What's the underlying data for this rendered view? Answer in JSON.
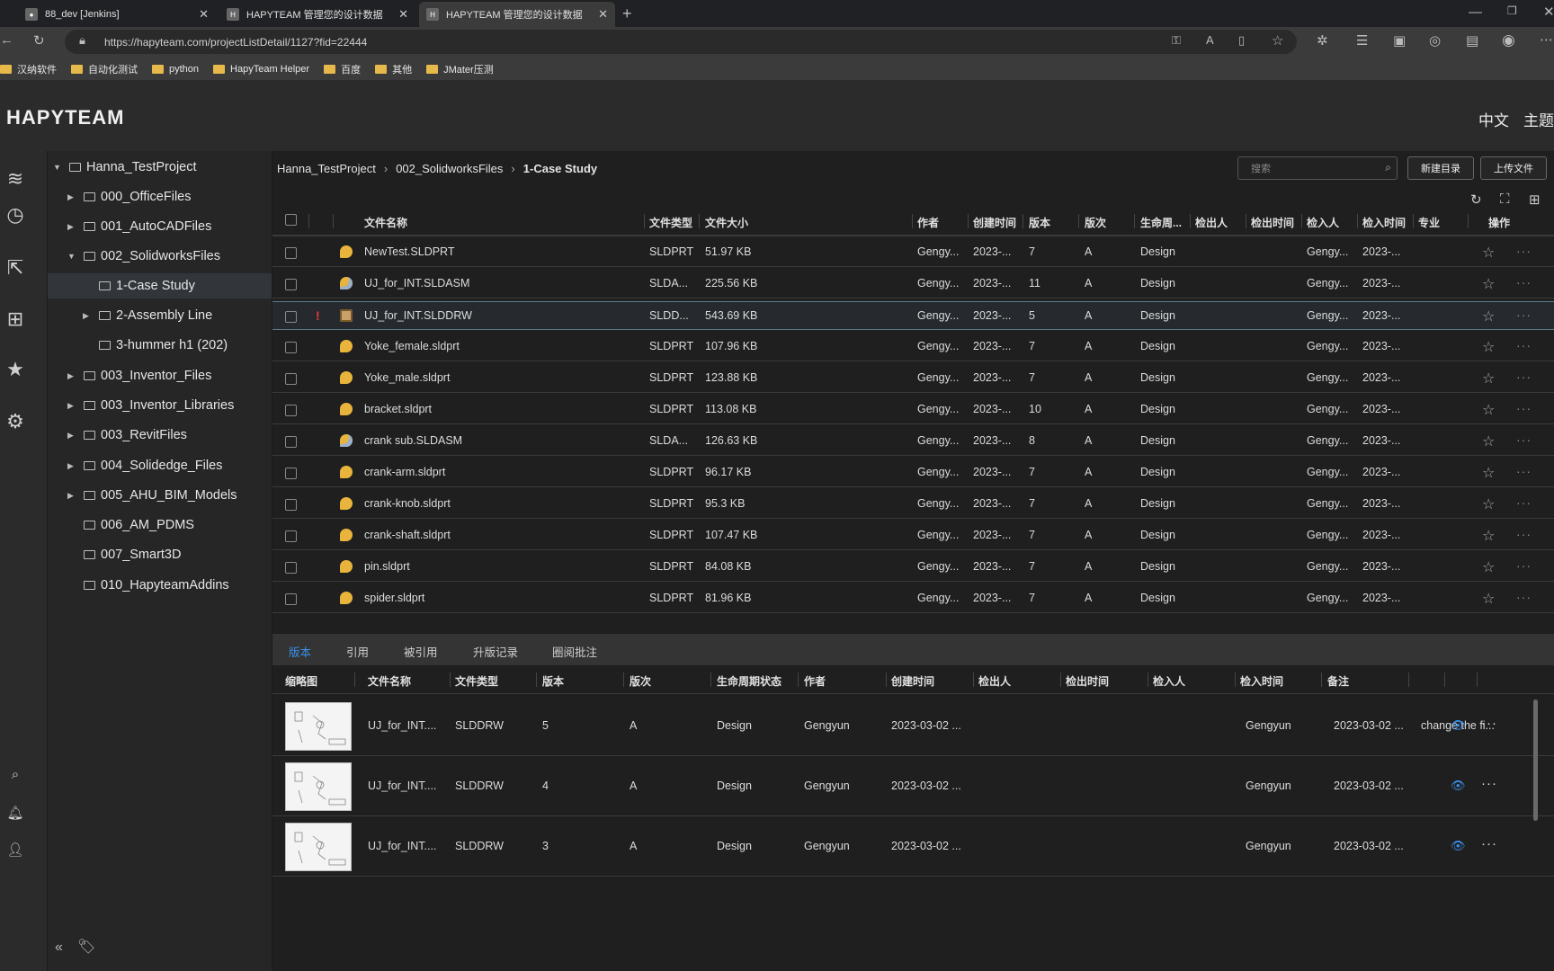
{
  "browser": {
    "tabs": [
      {
        "label": "88_dev [Jenkins]",
        "active": false
      },
      {
        "label": "HAPYTEAM 管理您的设计数据",
        "active": false
      },
      {
        "label": "HAPYTEAM 管理您的设计数据",
        "active": true
      }
    ],
    "url": "https://hapyteam.com/projectListDetail/1127?fid=22444",
    "bookmarks": [
      "汉纳软件",
      "自动化测试",
      "python",
      "HapyTeam Helper",
      "百度",
      "其他",
      "JMater压测"
    ]
  },
  "header": {
    "brand": "HAPYTEAM",
    "lang": "中文",
    "theme": "主题"
  },
  "tree": [
    {
      "label": "Hanna_TestProject",
      "level": 0,
      "caret": "▼"
    },
    {
      "label": "000_OfficeFiles",
      "level": 1,
      "caret": "▶"
    },
    {
      "label": "001_AutoCADFiles",
      "level": 1,
      "caret": "▶"
    },
    {
      "label": "002_SolidworksFiles",
      "level": 1,
      "caret": "▼"
    },
    {
      "label": "1-Case Study",
      "level": 2,
      "caret": "",
      "selected": true
    },
    {
      "label": "2-Assembly Line",
      "level": 2,
      "caret": "▶"
    },
    {
      "label": "3-hummer h1 (202)",
      "level": 2,
      "caret": ""
    },
    {
      "label": "003_Inventor_Files",
      "level": 1,
      "caret": "▶"
    },
    {
      "label": "003_Inventor_Libraries",
      "level": 1,
      "caret": "▶"
    },
    {
      "label": "003_RevitFiles",
      "level": 1,
      "caret": "▶"
    },
    {
      "label": "004_Solidedge_Files",
      "level": 1,
      "caret": "▶"
    },
    {
      "label": "005_AHU_BIM_Models",
      "level": 1,
      "caret": "▶"
    },
    {
      "label": "006_AM_PDMS",
      "level": 1,
      "caret": ""
    },
    {
      "label": "007_Smart3D",
      "level": 1,
      "caret": ""
    },
    {
      "label": "010_HapyteamAddins",
      "level": 1,
      "caret": ""
    }
  ],
  "breadcrumb": [
    "Hanna_TestProject",
    "002_SolidworksFiles",
    "1-Case Study"
  ],
  "search": {
    "placeholder": "搜索"
  },
  "buttons": {
    "new_folder": "新建目录",
    "upload": "上传文件"
  },
  "table": {
    "headers": [
      "文件名称",
      "文件类型",
      "文件大小",
      "作者",
      "创建时间",
      "版本",
      "版次",
      "生命周...",
      "检出人",
      "检出时间",
      "检入人",
      "检入时间",
      "专业",
      "操作"
    ],
    "rows": [
      {
        "name": "NewTest.SLDPRT",
        "type": "SLDPRT",
        "size": "51.97 KB",
        "author": "Gengy...",
        "created": "2023-...",
        "ver": "7",
        "rev": "A",
        "life": "Design",
        "checkin_by": "Gengy...",
        "checkin_time": "2023-...",
        "icon": "part"
      },
      {
        "name": "UJ_for_INT.SLDASM",
        "type": "SLDA...",
        "size": "225.56 KB",
        "author": "Gengy...",
        "created": "2023-...",
        "ver": "11",
        "rev": "A",
        "life": "Design",
        "checkin_by": "Gengy...",
        "checkin_time": "2023-...",
        "icon": "asm"
      },
      {
        "name": "UJ_for_INT.SLDDRW",
        "type": "SLDD...",
        "size": "543.69 KB",
        "author": "Gengy...",
        "created": "2023-...",
        "ver": "5",
        "rev": "A",
        "life": "Design",
        "checkin_by": "Gengy...",
        "checkin_time": "2023-...",
        "icon": "drw",
        "warn": "!",
        "selected": true
      },
      {
        "name": "Yoke_female.sldprt",
        "type": "SLDPRT",
        "size": "107.96 KB",
        "author": "Gengy...",
        "created": "2023-...",
        "ver": "7",
        "rev": "A",
        "life": "Design",
        "checkin_by": "Gengy...",
        "checkin_time": "2023-...",
        "icon": "part"
      },
      {
        "name": "Yoke_male.sldprt",
        "type": "SLDPRT",
        "size": "123.88 KB",
        "author": "Gengy...",
        "created": "2023-...",
        "ver": "7",
        "rev": "A",
        "life": "Design",
        "checkin_by": "Gengy...",
        "checkin_time": "2023-...",
        "icon": "part"
      },
      {
        "name": "bracket.sldprt",
        "type": "SLDPRT",
        "size": "113.08 KB",
        "author": "Gengy...",
        "created": "2023-...",
        "ver": "10",
        "rev": "A",
        "life": "Design",
        "checkin_by": "Gengy...",
        "checkin_time": "2023-...",
        "icon": "part"
      },
      {
        "name": "crank sub.SLDASM",
        "type": "SLDA...",
        "size": "126.63 KB",
        "author": "Gengy...",
        "created": "2023-...",
        "ver": "8",
        "rev": "A",
        "life": "Design",
        "checkin_by": "Gengy...",
        "checkin_time": "2023-...",
        "icon": "asm"
      },
      {
        "name": "crank-arm.sldprt",
        "type": "SLDPRT",
        "size": "96.17 KB",
        "author": "Gengy...",
        "created": "2023-...",
        "ver": "7",
        "rev": "A",
        "life": "Design",
        "checkin_by": "Gengy...",
        "checkin_time": "2023-...",
        "icon": "part"
      },
      {
        "name": "crank-knob.sldprt",
        "type": "SLDPRT",
        "size": "95.3 KB",
        "author": "Gengy...",
        "created": "2023-...",
        "ver": "7",
        "rev": "A",
        "life": "Design",
        "checkin_by": "Gengy...",
        "checkin_time": "2023-...",
        "icon": "part"
      },
      {
        "name": "crank-shaft.sldprt",
        "type": "SLDPRT",
        "size": "107.47 KB",
        "author": "Gengy...",
        "created": "2023-...",
        "ver": "7",
        "rev": "A",
        "life": "Design",
        "checkin_by": "Gengy...",
        "checkin_time": "2023-...",
        "icon": "part"
      },
      {
        "name": "pin.sldprt",
        "type": "SLDPRT",
        "size": "84.08 KB",
        "author": "Gengy...",
        "created": "2023-...",
        "ver": "7",
        "rev": "A",
        "life": "Design",
        "checkin_by": "Gengy...",
        "checkin_time": "2023-...",
        "icon": "part"
      },
      {
        "name": "spider.sldprt",
        "type": "SLDPRT",
        "size": "81.96 KB",
        "author": "Gengy...",
        "created": "2023-...",
        "ver": "7",
        "rev": "A",
        "life": "Design",
        "checkin_by": "Gengy...",
        "checkin_time": "2023-...",
        "icon": "part"
      }
    ]
  },
  "bottom": {
    "tabs": [
      "版本",
      "引用",
      "被引用",
      "升版记录",
      "圈阅批注"
    ],
    "active_tab": "版本",
    "headers": [
      "缩略图",
      "文件名称",
      "文件类型",
      "版本",
      "版次",
      "生命周期状态",
      "作者",
      "创建时间",
      "检出人",
      "检出时间",
      "检入人",
      "检入时间",
      "备注"
    ],
    "rows": [
      {
        "name": "UJ_for_INT....",
        "type": "SLDDRW",
        "ver": "5",
        "rev": "A",
        "life": "Design",
        "author": "Gengyun",
        "created": "2023-03-02 ...",
        "checkin_by": "Gengyun",
        "checkin_time": "2023-03-02 ...",
        "note": "change the fi..."
      },
      {
        "name": "UJ_for_INT....",
        "type": "SLDDRW",
        "ver": "4",
        "rev": "A",
        "life": "Design",
        "author": "Gengyun",
        "created": "2023-03-02 ...",
        "checkin_by": "Gengyun",
        "checkin_time": "2023-03-02 ...",
        "note": ""
      },
      {
        "name": "UJ_for_INT....",
        "type": "SLDDRW",
        "ver": "3",
        "rev": "A",
        "life": "Design",
        "author": "Gengyun",
        "created": "2023-03-02 ...",
        "checkin_by": "Gengyun",
        "checkin_time": "2023-03-02 ...",
        "note": ""
      }
    ]
  },
  "colors": {
    "accent": "#3a8fe8",
    "warn": "#e23b3b",
    "part_icon": "#e9b43c"
  }
}
